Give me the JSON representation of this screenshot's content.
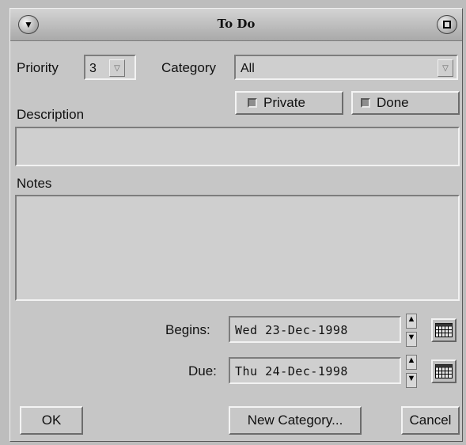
{
  "window": {
    "title": "To Do",
    "menu_icon": "chevron-down-icon",
    "maximize_icon": "maximize-icon"
  },
  "priority": {
    "label": "Priority",
    "value": "3",
    "arrow_icon": "chevron-down-icon"
  },
  "category": {
    "label": "Category",
    "value": "All",
    "arrow_icon": "chevron-down-icon"
  },
  "checkboxes": {
    "private": {
      "label": "Private",
      "checked": false
    },
    "done": {
      "label": "Done",
      "checked": false
    }
  },
  "description": {
    "label": "Description",
    "value": ""
  },
  "notes": {
    "label": "Notes",
    "value": ""
  },
  "begins": {
    "label": "Begins:",
    "value": "Wed  23-Dec-1998",
    "spinner_icon": "up-down-arrows-icon",
    "calendar_icon": "calendar-icon"
  },
  "due": {
    "label": "Due:",
    "value": "Thu  24-Dec-1998",
    "spinner_icon": "up-down-arrows-icon",
    "calendar_icon": "calendar-icon"
  },
  "buttons": {
    "ok": "OK",
    "new_category": "New Category...",
    "cancel": "Cancel"
  }
}
